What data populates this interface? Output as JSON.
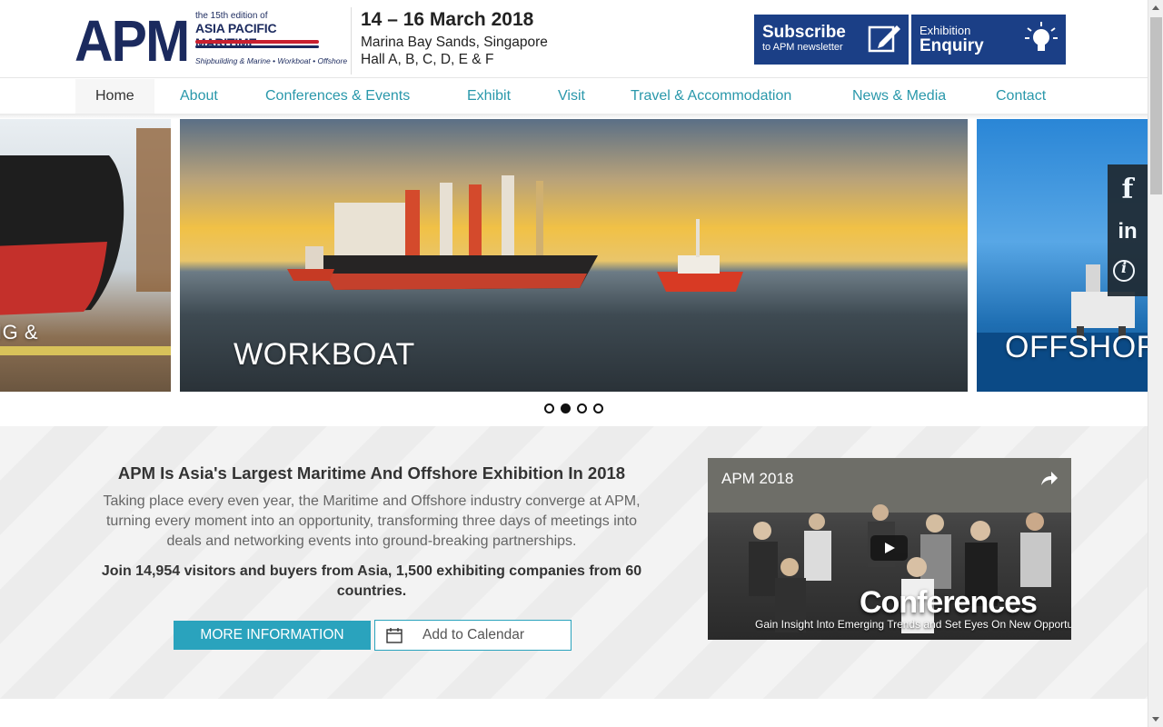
{
  "header": {
    "logo": {
      "acronym": "APM",
      "edition": "the 15th edition of",
      "name": "ASIA PACIFIC MARITIME",
      "tagline": "Shipbuilding & Marine • Workboat • Offshore"
    },
    "event": {
      "date": "14 – 16 March 2018",
      "venue": "Marina Bay Sands, Singapore",
      "hall": "Hall A, B, C, D, E & F"
    },
    "subscribe": {
      "title": "Subscribe",
      "subtitle": "to APM newsletter",
      "icon": "edit-icon"
    },
    "enquiry": {
      "small": "Exhibition",
      "big": "Enquiry",
      "icon": "lightbulb-icon"
    }
  },
  "nav": {
    "items": [
      {
        "label": "Home",
        "active": true
      },
      {
        "label": "About"
      },
      {
        "label": "Conferences & Events"
      },
      {
        "label": "Exhibit"
      },
      {
        "label": "Visit"
      },
      {
        "label": "Travel & Accommodation"
      },
      {
        "label": "News & Media"
      },
      {
        "label": "Contact"
      }
    ]
  },
  "slider": {
    "slides": [
      {
        "caption": "IG &"
      },
      {
        "caption": "WORKBOAT"
      },
      {
        "caption": "OFFSHOR"
      }
    ],
    "dots_count": 4,
    "active_dot": 2
  },
  "social": {
    "items": [
      {
        "label": "f",
        "icon": "facebook-icon"
      },
      {
        "label": "in",
        "icon": "linkedin-icon"
      },
      {
        "label": "i",
        "icon": "info-icon"
      }
    ]
  },
  "info": {
    "title": "APM Is Asia's Largest Maritime And Offshore Exhibition In 2018",
    "body": "Taking place every even year, the Maritime and Offshore industry converge at APM, turning every moment into an opportunity, transforming three days of meetings into deals and networking events into ground-breaking partnerships.",
    "highlight": "Join 14,954 visitors and buyers from Asia, 1,500 exhibiting companies from 60 countries.",
    "more_button": "MORE INFORMATION",
    "calendar_button": "Add to Calendar"
  },
  "video": {
    "title": "APM 2018",
    "heading": "Conferences",
    "subtitle": "Gain Insight Into Emerging Trends and Set Eyes On New Opportunities"
  },
  "colors": {
    "brand_navy": "#1b2a5e",
    "brand_red": "#c8202f",
    "cta_blue": "#1b3f86",
    "nav_teal": "#2a98ab",
    "button_teal": "#2aa3bd"
  }
}
